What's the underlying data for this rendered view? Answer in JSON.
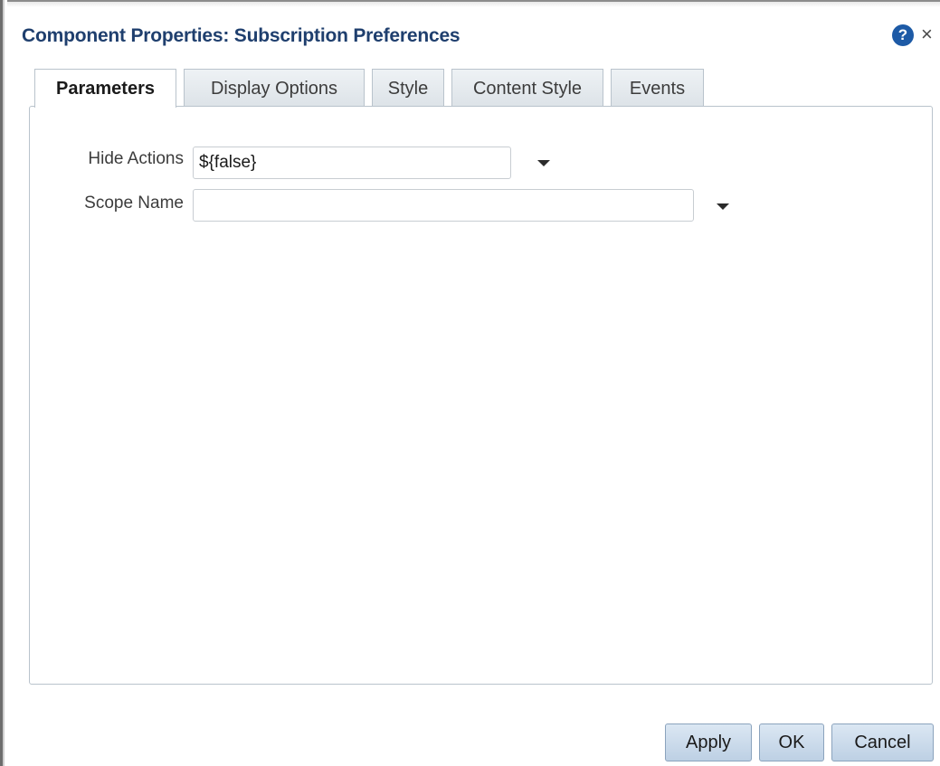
{
  "dialog": {
    "title": "Component Properties: Subscription Preferences",
    "help_icon": "?",
    "close_icon": "×"
  },
  "tabs": [
    {
      "label": "Parameters",
      "active": true
    },
    {
      "label": "Display Options",
      "active": false
    },
    {
      "label": "Style",
      "active": false
    },
    {
      "label": "Content Style",
      "active": false
    },
    {
      "label": "Events",
      "active": false
    }
  ],
  "fields": {
    "hide_actions": {
      "label": "Hide Actions",
      "value": "${false}"
    },
    "scope_name": {
      "label": "Scope Name",
      "value": ""
    }
  },
  "buttons": {
    "apply": "Apply",
    "ok": "OK",
    "cancel": "Cancel"
  },
  "icons": {
    "help": "help-icon",
    "close": "close-icon",
    "dropdown": "chevron-down-icon"
  },
  "colors": {
    "title": "#1f3f6e",
    "help_icon_bg": "#1d5aa6",
    "button_bg": "#c9d9ea"
  }
}
